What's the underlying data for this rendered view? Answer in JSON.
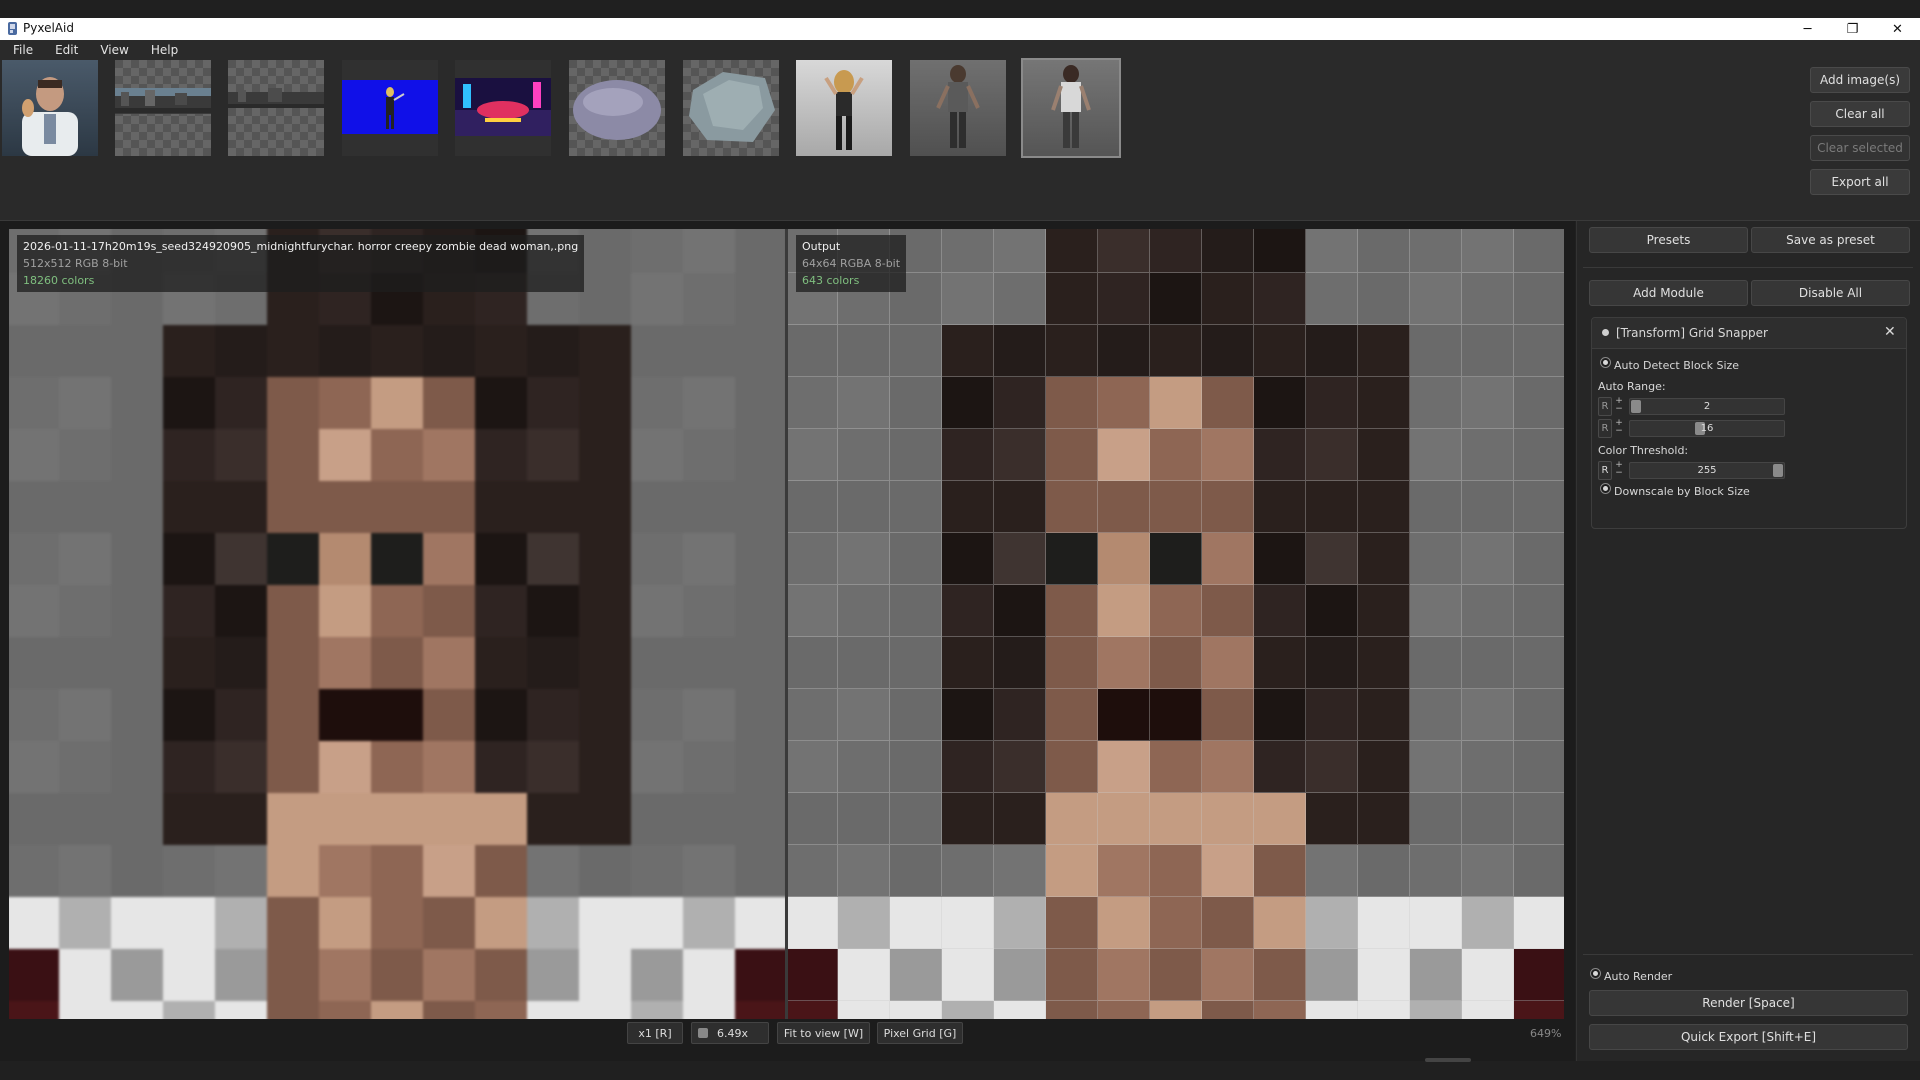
{
  "window": {
    "title": "PyxelAid",
    "controls": {
      "minimize": "─",
      "restore": "❐",
      "close": "✕"
    }
  },
  "menu": [
    "File",
    "Edit",
    "View",
    "Help"
  ],
  "image_actions": {
    "add": "Add image(s)",
    "clear_all": "Clear all",
    "clear_selected": "Clear selected",
    "export_all": "Export all"
  },
  "input_view": {
    "filename": "2026-01-11-17h20m19s_seed324920905_midnightfurychar. horror creepy zombie dead woman,.png",
    "meta": "512x512  RGB  8-bit",
    "colors": "18260 colors"
  },
  "output_view": {
    "title": "Output",
    "meta": "64x64  RGBA  8-bit",
    "colors": "643 colors"
  },
  "bottom_toolbar": {
    "scale": "x1 [R]",
    "zoom_value": "6.49x",
    "fit": "Fit to view [W]",
    "pixel_grid": "Pixel Grid [G]",
    "zoom_percent": "649%"
  },
  "panel": {
    "presets": "Presets",
    "save_preset": "Save as preset",
    "add_module": "Add Module",
    "disable_all": "Disable All",
    "module": {
      "title": "[Transform] Grid Snapper",
      "close": "✕",
      "auto_detect": "Auto Detect Block Size",
      "auto_range_label": "Auto Range:",
      "range_min": "2",
      "range_max": "16",
      "range_min_fraction": 0.0,
      "range_max_fraction": 0.45,
      "color_threshold_label": "Color Threshold:",
      "color_threshold": "255",
      "color_threshold_fraction": 1.0,
      "downscale": "Downscale by Block Size",
      "r_label": "R",
      "plus": "+",
      "minus": "−"
    },
    "auto_render": "Auto Render",
    "render": "Render  [Space]",
    "quick_export": "Quick Export  [Shift+E]"
  },
  "icons": {
    "app": "pyxelaid-logo-icon",
    "close_module": "close-icon"
  },
  "colors": {
    "accent_green": "#7fbf7f",
    "panel_bg": "#262626",
    "button_bg": "#363636"
  }
}
